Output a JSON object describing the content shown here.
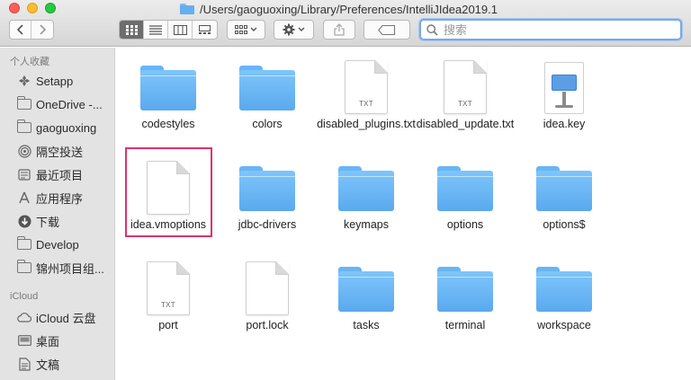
{
  "window": {
    "title": "/Users/gaoguoxing/Library/Preferences/IntelliJIdea2019.1"
  },
  "toolbar": {
    "back_icon": "chevron-left-icon",
    "forward_icon": "chevron-right-icon",
    "views": [
      "icon-view",
      "list-view",
      "column-view",
      "gallery-view"
    ],
    "active_view": "icon-view",
    "search_placeholder": "搜索"
  },
  "sidebar": {
    "favorites_heading": "个人收藏",
    "favorites": [
      {
        "label": "Setapp",
        "icon": "setapp-icon"
      },
      {
        "label": "OneDrive -...",
        "icon": "folder-icon"
      },
      {
        "label": "gaoguoxing",
        "icon": "home-folder-icon"
      },
      {
        "label": "隔空投送",
        "icon": "airdrop-icon"
      },
      {
        "label": "最近项目",
        "icon": "recents-icon"
      },
      {
        "label": "应用程序",
        "icon": "applications-icon"
      },
      {
        "label": "下载",
        "icon": "downloads-icon"
      },
      {
        "label": "Develop",
        "icon": "folder-icon"
      },
      {
        "label": "锦州项目组...",
        "icon": "folder-icon"
      }
    ],
    "icloud_heading": "iCloud",
    "icloud": [
      {
        "label": "iCloud 云盘",
        "icon": "icloud-icon"
      },
      {
        "label": "桌面",
        "icon": "desktop-icon"
      },
      {
        "label": "文稿",
        "icon": "documents-icon"
      }
    ]
  },
  "files": [
    {
      "name": "codestyles",
      "type": "folder"
    },
    {
      "name": "colors",
      "type": "folder"
    },
    {
      "name": "disabled_plugins.txt",
      "type": "txt",
      "ext": "TXT"
    },
    {
      "name": "disabled_update.txt",
      "type": "txt",
      "ext": "TXT"
    },
    {
      "name": "idea.key",
      "type": "keynote"
    },
    {
      "name": "idea.vmoptions",
      "type": "doc",
      "selected": true
    },
    {
      "name": "jdbc-drivers",
      "type": "folder"
    },
    {
      "name": "keymaps",
      "type": "folder"
    },
    {
      "name": "options",
      "type": "folder"
    },
    {
      "name": "options$",
      "type": "folder"
    },
    {
      "name": "port",
      "type": "txt",
      "ext": "TXT"
    },
    {
      "name": "port.lock",
      "type": "doc"
    },
    {
      "name": "tasks",
      "type": "folder"
    },
    {
      "name": "terminal",
      "type": "folder"
    },
    {
      "name": "workspace",
      "type": "folder"
    }
  ],
  "colors": {
    "selection_outline": "#e0306e",
    "folder_blue": "#68b5f5"
  }
}
